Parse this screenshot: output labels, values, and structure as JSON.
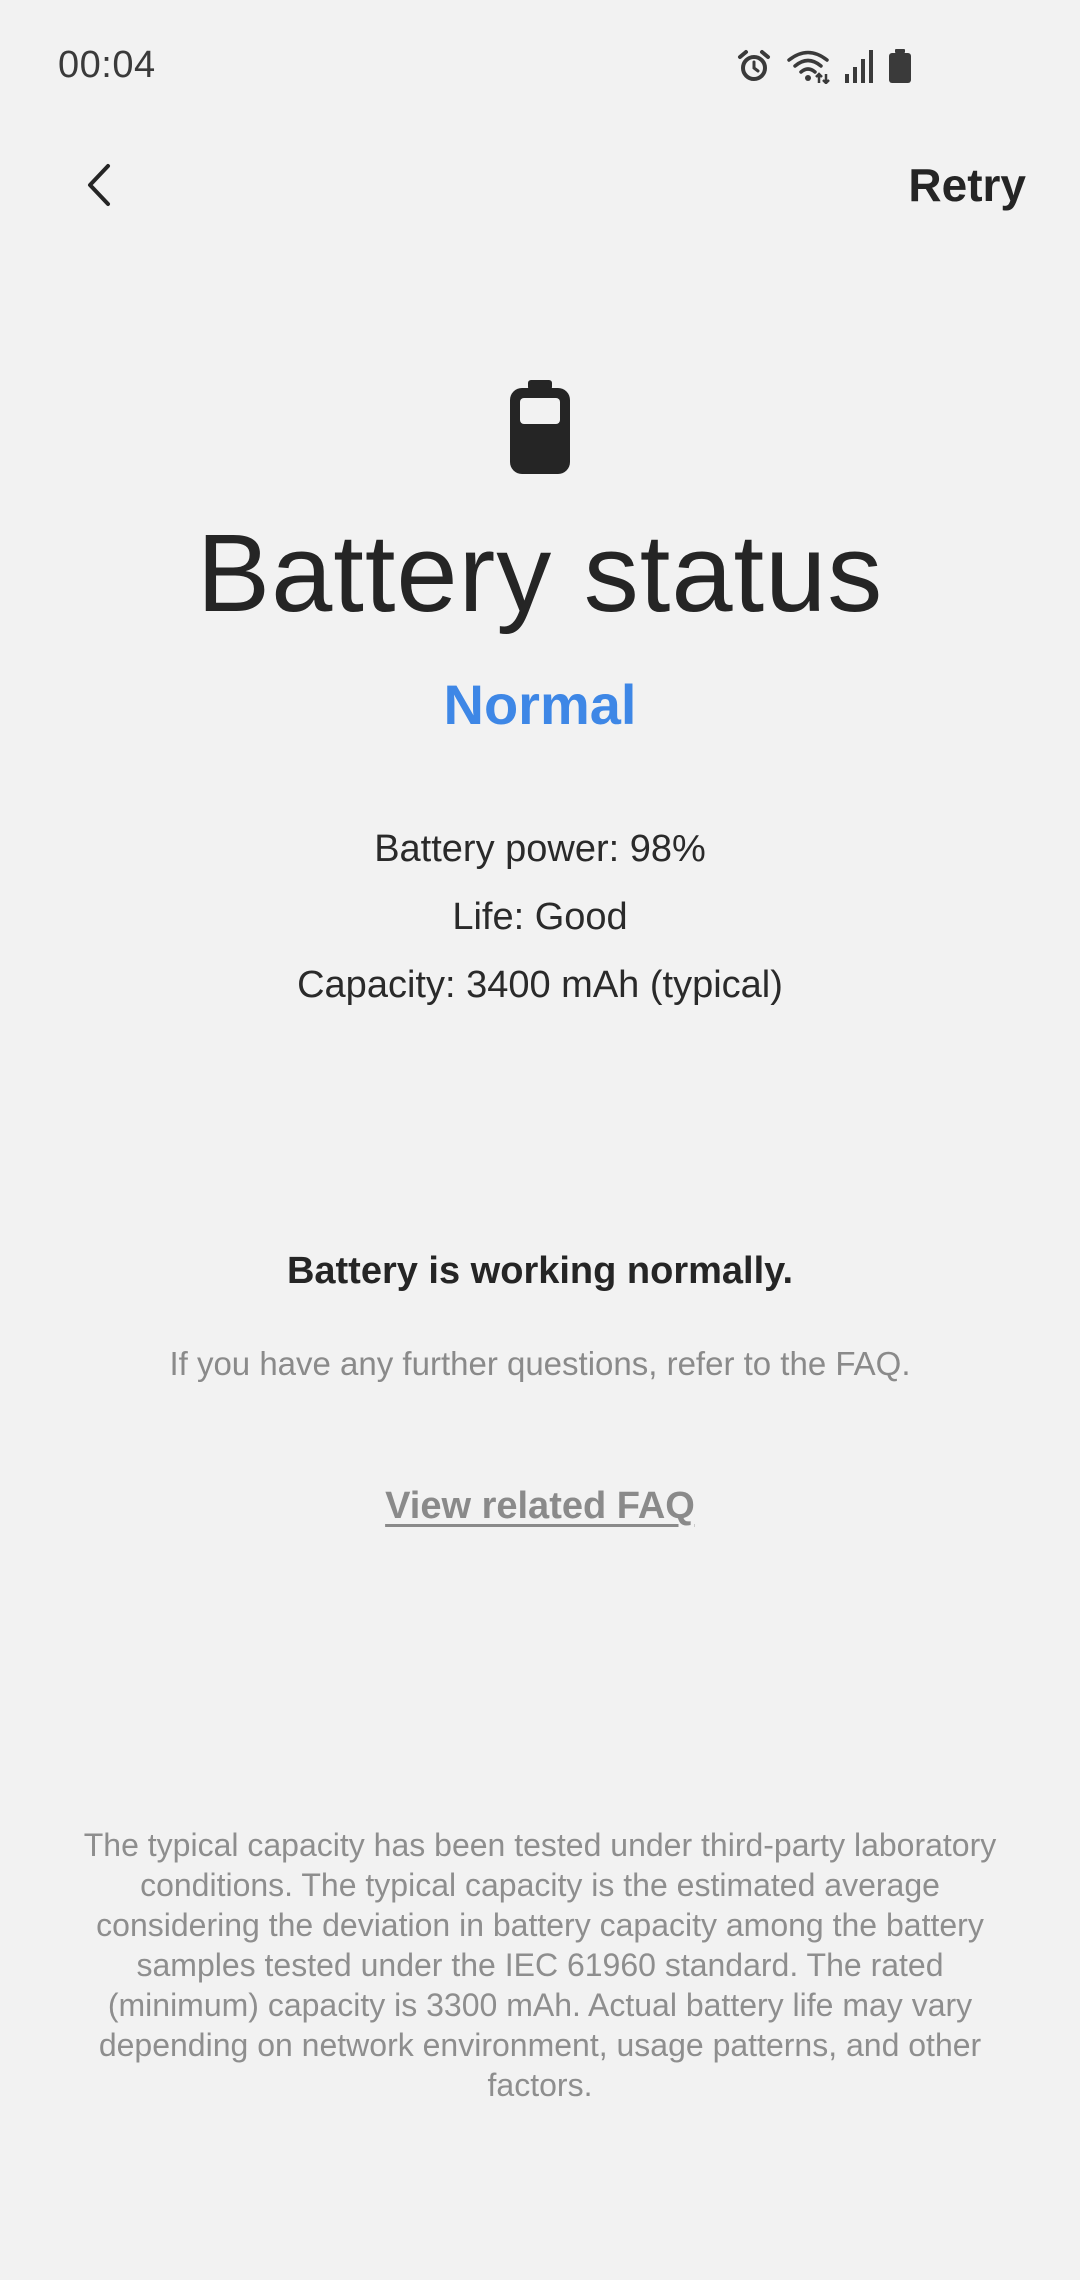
{
  "status_bar": {
    "time": "00:04",
    "icons": [
      "alarm-icon",
      "wifi-icon",
      "signal-icon",
      "battery-icon"
    ]
  },
  "app_bar": {
    "back_icon": "chevron-left-icon",
    "retry_label": "Retry"
  },
  "main": {
    "icon": "battery-icon",
    "title": "Battery status",
    "status": "Normal",
    "status_color": "#3e87e6",
    "details": [
      "Battery power: 98%",
      "Life: Good",
      "Capacity: 3400 mAh (typical)"
    ],
    "message": "Battery is working normally.",
    "subtext": "If you have any further questions, refer to the FAQ.",
    "faq_link": "View related FAQ",
    "footnote": "The typical capacity has been tested under third-party laboratory conditions. The typical capacity is the estimated average considering the deviation in battery capacity among the battery samples tested under the IEC 61960 standard. The rated (minimum) capacity is 3300 mAh. Actual battery life may vary depending on network environment, usage patterns, and other factors."
  }
}
